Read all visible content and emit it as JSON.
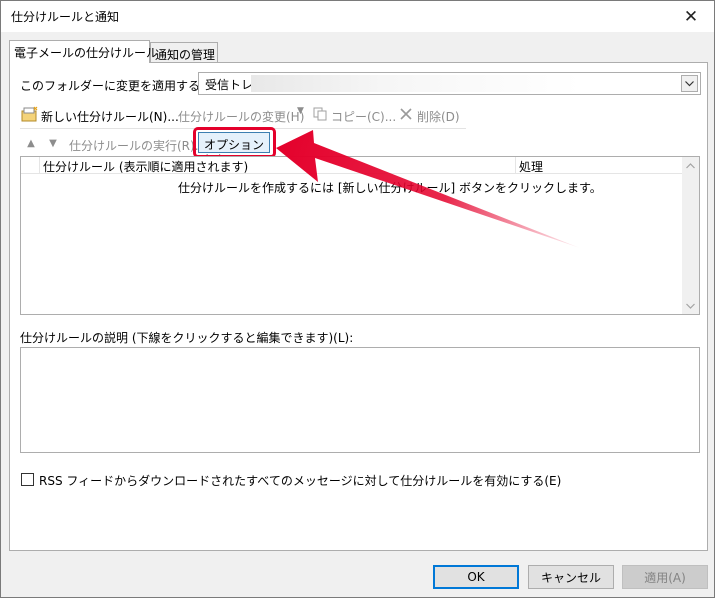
{
  "window": {
    "title": "仕分けルールと通知"
  },
  "tabs": [
    {
      "label": "電子メールの仕分けルール"
    },
    {
      "label": "通知の管理"
    }
  ],
  "folder": {
    "label": "このフォルダーに変更を適用する(F):",
    "value": "受信トレイ"
  },
  "toolbar": {
    "new_rule": "新しい仕分けルール(N)...",
    "change_rule": "仕分けルールの変更(H)",
    "copy": "コピー(C)...",
    "delete": "削除(D)",
    "run_rules": "仕分けルールの実行(R)...",
    "options": "オプション(O)"
  },
  "rules_list": {
    "columns": [
      "仕分けルール (表示順に適用されます)",
      "処理"
    ],
    "empty_message": "仕分けルールを作成するには [新しい仕分けルール] ボタンをクリックします。"
  },
  "description": {
    "label": "仕分けルールの説明 (下線をクリックすると編集できます)(L):"
  },
  "rss": {
    "label": "RSS フィードからダウンロードされたすべてのメッセージに対して仕分けルールを有効にする(E)",
    "checked": false
  },
  "buttons": {
    "ok": "OK",
    "cancel": "キャンセル",
    "apply": "適用(A)"
  },
  "colors": {
    "annotation_red": "#e4002b",
    "focus_blue": "#0078d7"
  }
}
